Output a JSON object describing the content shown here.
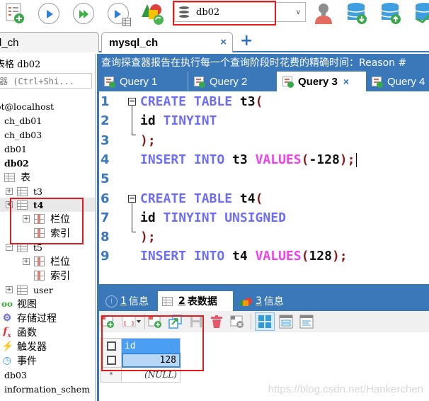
{
  "toolbar": {
    "buttons": [
      {
        "name": "new-query",
        "icon": "new-query-icon"
      },
      {
        "name": "run",
        "icon": "play-icon"
      },
      {
        "name": "run-all",
        "icon": "fast-forward-icon"
      },
      {
        "name": "run-to-grid",
        "icon": "play-grid-icon"
      },
      {
        "name": "schema-sync",
        "icon": "shapes-sync-icon"
      },
      {
        "name": "user-manager",
        "icon": "user-icon"
      },
      {
        "name": "backup-db",
        "icon": "database-download-icon"
      },
      {
        "name": "restore-db",
        "icon": "database-upload-icon"
      },
      {
        "name": "db-tool",
        "icon": "database-check-icon"
      }
    ],
    "database_select": {
      "value": "db02",
      "icon": "database-icon"
    }
  },
  "connection_tabs": [
    {
      "label": "l_ch",
      "active": false
    },
    {
      "label": "mysql_ch",
      "active": true,
      "close": "×"
    }
  ],
  "new_tab_label": "+",
  "sidebar": {
    "title": "表格 db02",
    "search_placeholder": "器 (Ctrl+Shi...",
    "tree": [
      {
        "label": "ot@localhost",
        "level": 0
      },
      {
        "label": "ch_db01",
        "level": 1
      },
      {
        "label": "ch_db03",
        "level": 1
      },
      {
        "label": "db01",
        "level": 1
      },
      {
        "label": "db02",
        "level": 1,
        "bold": true
      },
      {
        "label": "表",
        "level": 1,
        "icon": "table-icon"
      },
      {
        "label": "t3",
        "level": 2,
        "expander": "+"
      },
      {
        "label": "t4",
        "level": 2,
        "expander": "+",
        "selected": true
      },
      {
        "label": "栏位",
        "level": 3,
        "expander": "+"
      },
      {
        "label": "索引",
        "level": 3
      },
      {
        "label": "t5",
        "level": 2,
        "expander": "−"
      },
      {
        "label": "栏位",
        "level": 3,
        "expander": "+"
      },
      {
        "label": "索引",
        "level": 3
      },
      {
        "label": "user",
        "level": 2,
        "expander": "+"
      },
      {
        "label": "视图",
        "icon": "views-icon"
      },
      {
        "label": "存储过程",
        "icon": "stored-procedure-icon"
      },
      {
        "label": "函数",
        "icon": "function-icon"
      },
      {
        "label": "触发器",
        "icon": "trigger-icon"
      },
      {
        "label": "事件",
        "icon": "event-icon"
      },
      {
        "label": "db03"
      },
      {
        "label": "information_schem"
      }
    ]
  },
  "main": {
    "info_banner": "查询探查器报告在执行每一个查询阶段时花费的精确时间：Reason #",
    "query_tabs": [
      {
        "label": "Query 1",
        "active": false
      },
      {
        "label": "Query 2",
        "active": false
      },
      {
        "label": "Query 3",
        "active": true,
        "close": "×"
      },
      {
        "label": "Query 4",
        "active": false
      }
    ],
    "editor": {
      "lines": [
        {
          "n": "1",
          "tokens": [
            [
              "kw",
              "CREATE TABLE "
            ],
            [
              "id",
              "t3"
            ],
            [
              "pn",
              "("
            ]
          ]
        },
        {
          "n": "2",
          "tokens": [
            [
              "id",
              "id "
            ],
            [
              "kw",
              "TINYINT"
            ]
          ]
        },
        {
          "n": "3",
          "tokens": [
            [
              "pn",
              ");"
            ]
          ]
        },
        {
          "n": "4",
          "tokens": [
            [
              "kw",
              "INSERT INTO "
            ],
            [
              "id",
              "t3 "
            ],
            [
              "fn",
              "VALUES"
            ],
            [
              "pn",
              "("
            ],
            [
              "id",
              "-128"
            ],
            [
              "pn",
              ");"
            ]
          ]
        },
        {
          "n": "5",
          "tokens": []
        },
        {
          "n": "6",
          "tokens": [
            [
              "kw",
              "CREATE TABLE "
            ],
            [
              "id",
              "t4"
            ],
            [
              "pn",
              "("
            ]
          ]
        },
        {
          "n": "7",
          "tokens": [
            [
              "id",
              "id "
            ],
            [
              "kw",
              "TINYINT UNSIGNED"
            ]
          ]
        },
        {
          "n": "8",
          "tokens": [
            [
              "pn",
              ");"
            ]
          ]
        },
        {
          "n": "9",
          "tokens": [
            [
              "kw",
              "INSERT INTO "
            ],
            [
              "id",
              "t4 "
            ],
            [
              "fn",
              "VALUES"
            ],
            [
              "pn",
              "("
            ],
            [
              "id",
              "128"
            ],
            [
              "pn",
              ");"
            ]
          ]
        }
      ]
    },
    "result_tabs": [
      {
        "num": "1",
        "label": "信息",
        "icon": "info-icon",
        "active": false
      },
      {
        "num": "2",
        "label": "表数据",
        "icon": "table-icon",
        "active": true
      },
      {
        "num": "3",
        "label": "信息",
        "icon": "shapes-icon",
        "active": false
      }
    ],
    "result_toolbar": [
      "insert-row-icon",
      "filter-dropdown-icon",
      "duplicate-row-icon",
      "import-icon",
      "save-icon",
      "delete-icon",
      "cancel-icon",
      "grid-view-icon",
      "form-view-icon",
      "text-view-icon"
    ],
    "grid": {
      "columns": [
        "id"
      ],
      "rows": [
        [
          "128"
        ]
      ],
      "new_row_marker": "*",
      "null_label": "(NULL)"
    },
    "watermark": "https://blog.csdn.net/Hankerchen"
  },
  "colors": {
    "accent": "#3a78b9",
    "highlight_red": "#e21c1c",
    "keyword": "#6d6dfb",
    "function": "#f23ff0",
    "grid_header": "#4a9ff5"
  }
}
